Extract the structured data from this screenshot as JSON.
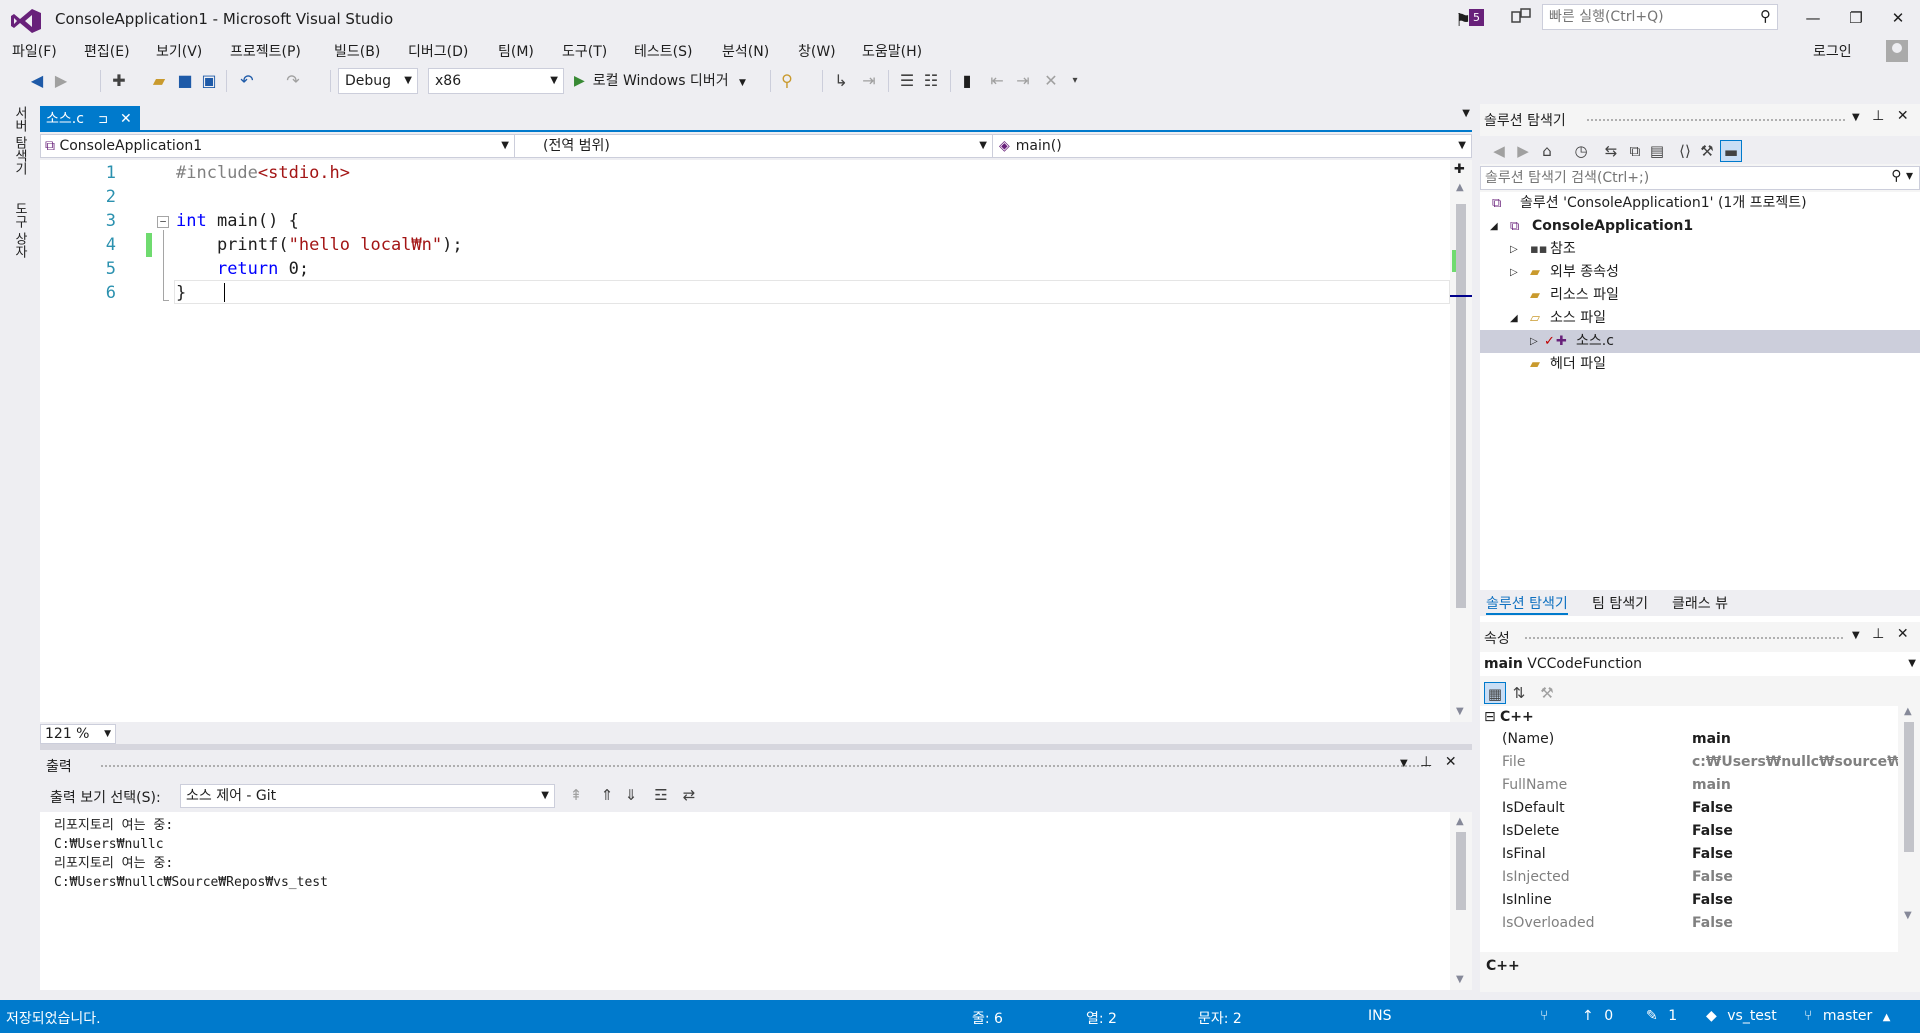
{
  "window": {
    "title": "ConsoleApplication1 - Microsoft Visual Studio",
    "notification_count": "5",
    "quick_launch_placeholder": "빠른 실행(Ctrl+Q)",
    "min_glyph": "—",
    "max_glyph": "❐",
    "close_glyph": "✕"
  },
  "menu": {
    "items": [
      "파일(F)",
      "편집(E)",
      "보기(V)",
      "프로젝트(P)",
      "빌드(B)",
      "디버그(D)",
      "팀(M)",
      "도구(T)",
      "테스트(S)",
      "분석(N)",
      "창(W)",
      "도움말(H)"
    ],
    "login": "로그인"
  },
  "toolbar": {
    "config": "Debug",
    "platform": "x86",
    "run_label": "로컬 Windows 디버거"
  },
  "side_tabs": [
    "서버 탐색기",
    "도구 상자"
  ],
  "editor": {
    "tab_label": "소스.c",
    "nav_project": "ConsoleApplication1",
    "nav_scope": "(전역 범위)",
    "nav_member": "main()",
    "zoom": "121 %",
    "lines": [
      {
        "num": "1",
        "parts": [
          {
            "cls": "pp",
            "text": "#include"
          },
          {
            "cls": "inc",
            "text": "<stdio.h>"
          }
        ]
      },
      {
        "num": "2",
        "parts": []
      },
      {
        "num": "3",
        "parts": [
          {
            "cls": "kw",
            "text": "int"
          },
          {
            "cls": "",
            "text": " main() {"
          }
        ]
      },
      {
        "num": "4",
        "parts": [
          {
            "cls": "",
            "text": "    printf("
          },
          {
            "cls": "str",
            "text": "\"hello local₩n\""
          },
          {
            "cls": "",
            "text": ");"
          }
        ]
      },
      {
        "num": "5",
        "parts": [
          {
            "cls": "",
            "text": "    "
          },
          {
            "cls": "kw",
            "text": "return"
          },
          {
            "cls": "",
            "text": " 0;"
          }
        ]
      },
      {
        "num": "6",
        "parts": [
          {
            "cls": "",
            "text": "}"
          }
        ]
      }
    ]
  },
  "output": {
    "title": "출력",
    "source_label": "출력 보기 선택(S):",
    "source_value": "소스 제어 - Git",
    "lines": [
      "리포지토리 여는 중:",
      "C:₩Users₩nullc",
      "리포지토리 여는 중:",
      "C:₩Users₩nullc₩Source₩Repos₩vs_test"
    ]
  },
  "solution_explorer": {
    "title": "솔루션 탐색기",
    "search_placeholder": "솔루션 탐색기 검색(Ctrl+;)",
    "tree": [
      {
        "label": "솔루션 'ConsoleApplication1' (1개 프로젝트)",
        "icon": "solution-icon"
      },
      {
        "label": "ConsoleApplication1",
        "icon": "project-icon"
      },
      {
        "label": "참조",
        "icon": "references-icon"
      },
      {
        "label": "외부 종속성",
        "icon": "folder-icon"
      },
      {
        "label": "리소스 파일",
        "icon": "folder-icon"
      },
      {
        "label": "소스 파일",
        "icon": "folder-open-icon"
      },
      {
        "label": "소스.c",
        "icon": "cpp-file-icon"
      },
      {
        "label": "헤더 파일",
        "icon": "folder-icon"
      }
    ],
    "bottom_tabs": [
      "솔루션 탐색기",
      "팀 탐색기",
      "클래스 뷰"
    ]
  },
  "properties": {
    "title": "속성",
    "object_name": "main",
    "object_type": "VCCodeFunction",
    "category": "C++",
    "rows": [
      {
        "name": "(Name)",
        "value": "main",
        "dim": false
      },
      {
        "name": "File",
        "value": "c:₩Users₩nullc₩source₩repos",
        "dim": true
      },
      {
        "name": "FullName",
        "value": "main",
        "dim": true
      },
      {
        "name": "IsDefault",
        "value": "False",
        "dim": false
      },
      {
        "name": "IsDelete",
        "value": "False",
        "dim": false
      },
      {
        "name": "IsFinal",
        "value": "False",
        "dim": false
      },
      {
        "name": "IsInjected",
        "value": "False",
        "dim": true
      },
      {
        "name": "IsInline",
        "value": "False",
        "dim": false
      },
      {
        "name": "IsOverloaded",
        "value": "False",
        "dim": true
      }
    ],
    "description": "C++"
  },
  "statusbar": {
    "message": "저장되었습니다.",
    "line": "줄: 6",
    "col": "열: 2",
    "char": "문자: 2",
    "mode": "INS",
    "push_count": "0",
    "changes_count": "1",
    "repo": "vs_test",
    "branch": "master"
  },
  "colors": {
    "accent": "#007ACC",
    "vs_purple": "#68217A",
    "keyword": "#0000FF",
    "string": "#A31515",
    "line_number": "#2B91AF"
  }
}
